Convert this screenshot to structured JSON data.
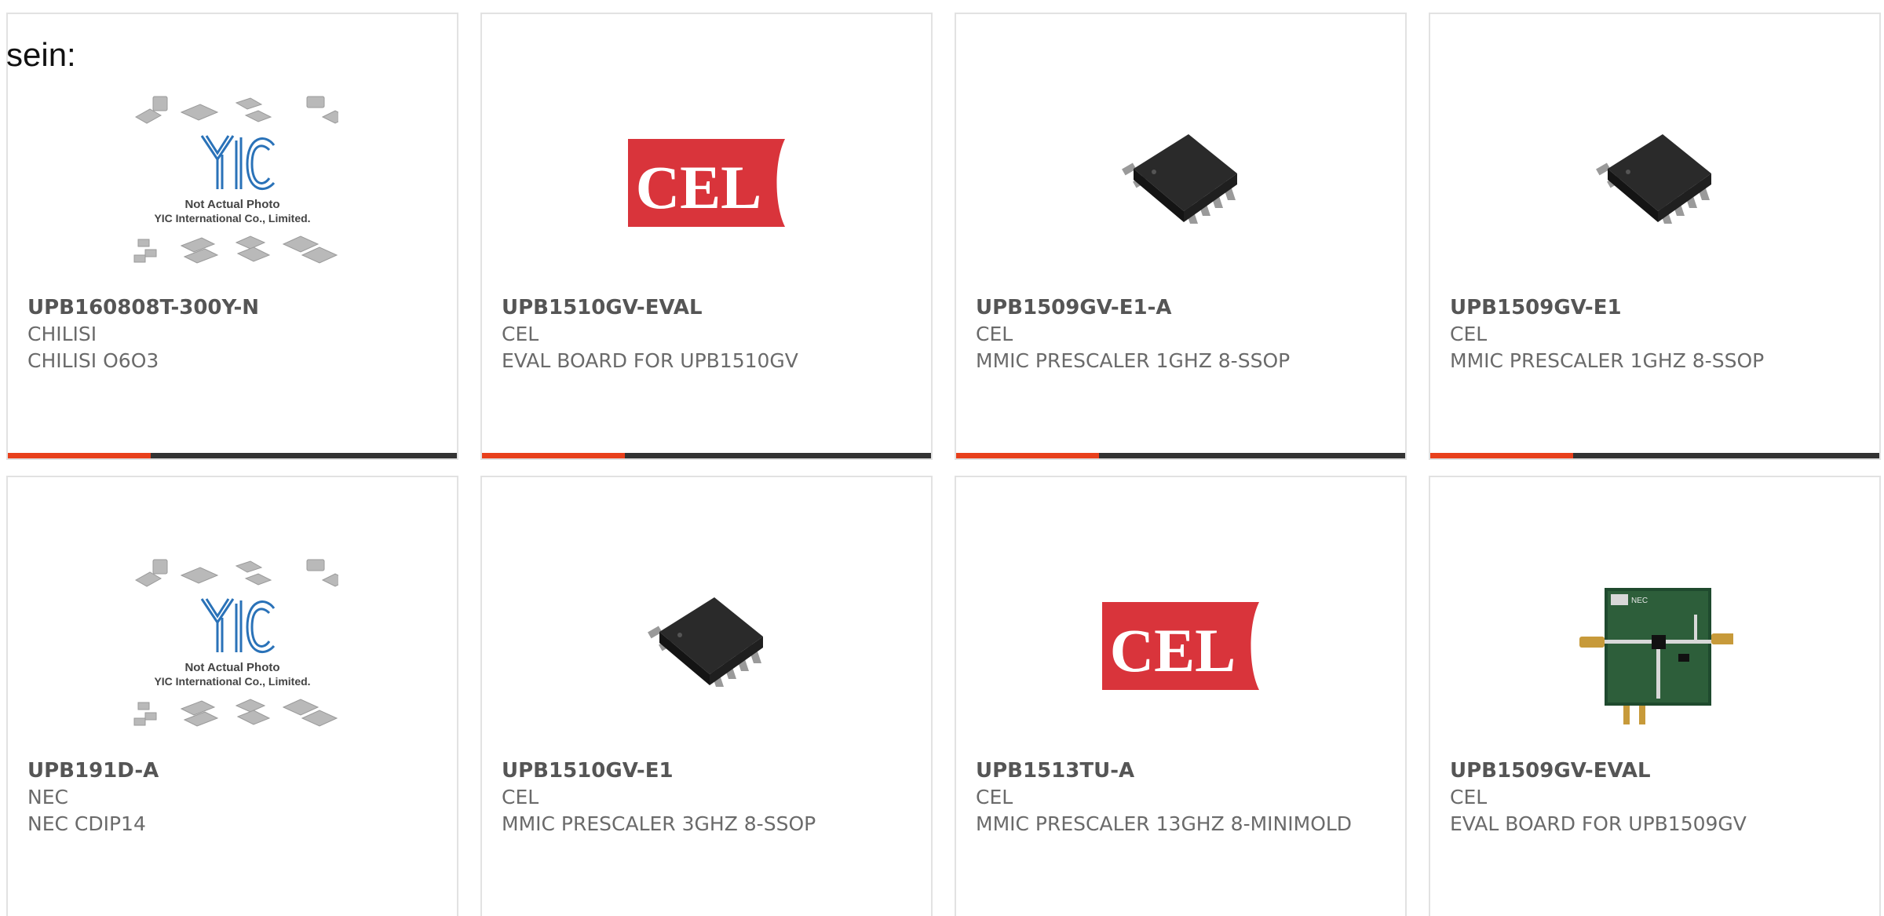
{
  "heading": "sein:",
  "accent_color": "#e8401c",
  "bar_color": "#333333",
  "placeholder": {
    "caption_line1": "Not Actual Photo",
    "caption_line2": "YIC International Co., Limited.",
    "logo_text": "YIC"
  },
  "cel_logo_text": "CEL",
  "board_label": "NEC",
  "products": [
    {
      "part": "UPB160808T-300Y-N",
      "manufacturer": "CHILISI",
      "description": "CHILISI O6O3",
      "image": "yic-placeholder"
    },
    {
      "part": "UPB1510GV-EVAL",
      "manufacturer": "CEL",
      "description": "EVAL BOARD FOR UPB1510GV",
      "image": "cel-logo"
    },
    {
      "part": "UPB1509GV-E1-A",
      "manufacturer": "CEL",
      "description": "MMIC PRESCALER 1GHZ 8-SSOP",
      "image": "ssop-chip"
    },
    {
      "part": "UPB1509GV-E1",
      "manufacturer": "CEL",
      "description": "MMIC PRESCALER 1GHZ 8-SSOP",
      "image": "ssop-chip"
    },
    {
      "part": "UPB191D-A",
      "manufacturer": "NEC",
      "description": "NEC CDIP14",
      "image": "yic-placeholder"
    },
    {
      "part": "UPB1510GV-E1",
      "manufacturer": "CEL",
      "description": "MMIC PRESCALER 3GHZ 8-SSOP",
      "image": "ssop-chip"
    },
    {
      "part": "UPB1513TU-A",
      "manufacturer": "CEL",
      "description": "MMIC PRESCALER 13GHZ 8-MINIMOLD",
      "image": "cel-logo"
    },
    {
      "part": "UPB1509GV-EVAL",
      "manufacturer": "CEL",
      "description": "EVAL BOARD FOR UPB1509GV",
      "image": "eval-board"
    }
  ]
}
